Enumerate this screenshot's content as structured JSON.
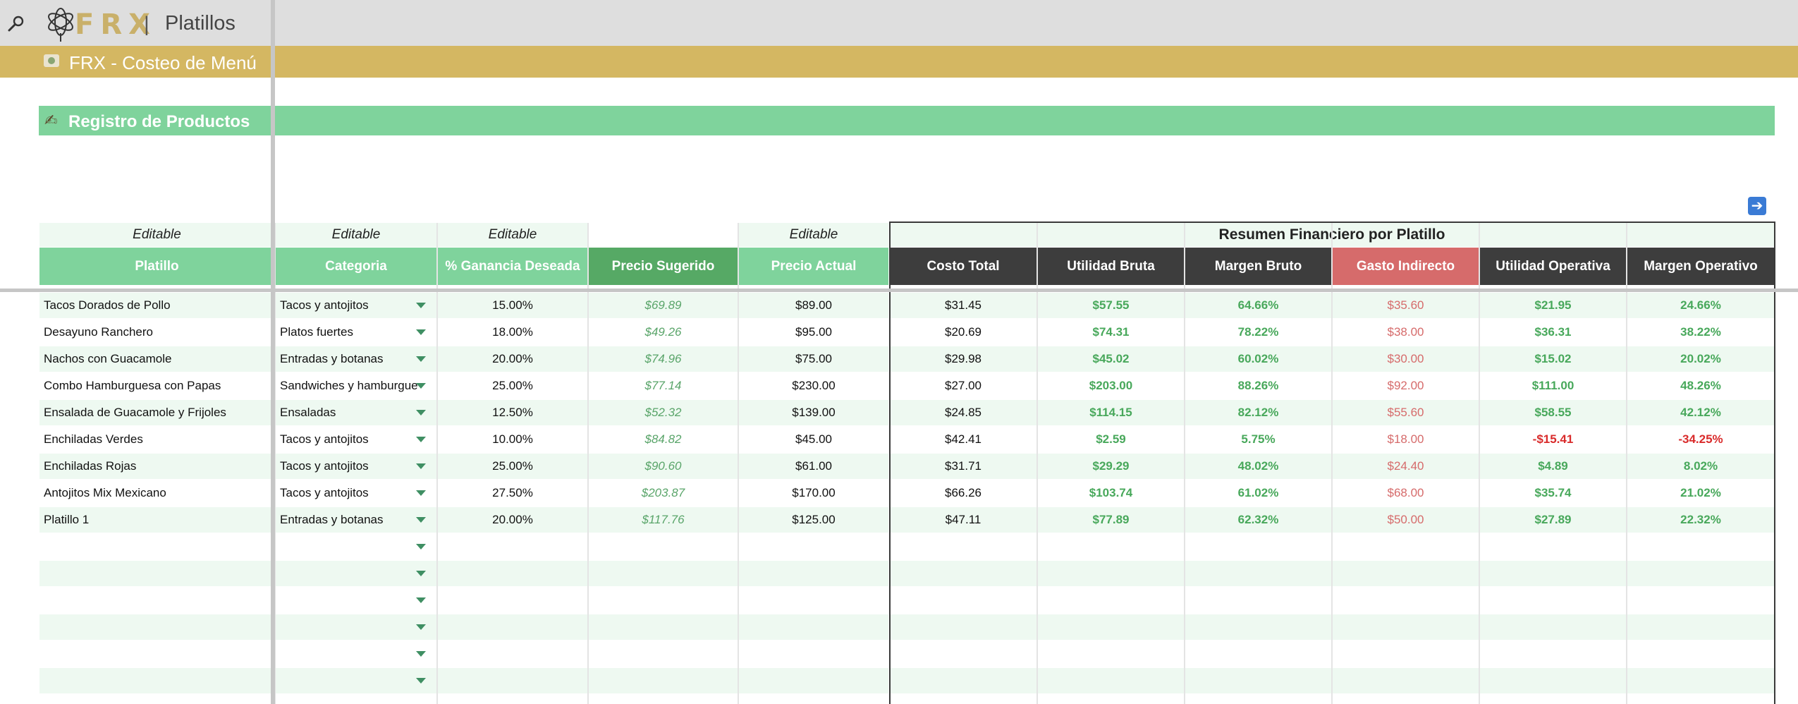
{
  "app": {
    "logo_text": "FRX",
    "separator": "|",
    "sheet_title": "Platillos"
  },
  "band": {
    "title": "FRX - Costeo de Menú"
  },
  "section": {
    "title": "Registro de Productos"
  },
  "editable_label": "Editable",
  "summary_title": "Resumen Financiero por Platillo",
  "columns": [
    "Platillo",
    "Categoria",
    "% Ganancia Deseada",
    "Precio Sugerido",
    "Precio Actual",
    "Costo Total",
    "Utilidad Bruta",
    "Margen Bruto",
    "Gasto Indirecto",
    "Utilidad Operativa",
    "Margen Operativo"
  ],
  "rows": [
    [
      "Tacos Dorados de Pollo",
      "Tacos y antojitos",
      "15.00%",
      "$69.89",
      "$89.00",
      "$31.45",
      "$57.55",
      "64.66%",
      "$35.60",
      "$21.95",
      "24.66%"
    ],
    [
      "Desayuno Ranchero",
      "Platos fuertes",
      "18.00%",
      "$49.26",
      "$95.00",
      "$20.69",
      "$74.31",
      "78.22%",
      "$38.00",
      "$36.31",
      "38.22%"
    ],
    [
      "Nachos con Guacamole",
      "Entradas y botanas",
      "20.00%",
      "$74.96",
      "$75.00",
      "$29.98",
      "$45.02",
      "60.02%",
      "$30.00",
      "$15.02",
      "20.02%"
    ],
    [
      "Combo Hamburguesa con Papas",
      "Sandwiches y hamburgue",
      "25.00%",
      "$77.14",
      "$230.00",
      "$27.00",
      "$203.00",
      "88.26%",
      "$92.00",
      "$111.00",
      "48.26%"
    ],
    [
      "Ensalada de Guacamole y Frijoles",
      "Ensaladas",
      "12.50%",
      "$52.32",
      "$139.00",
      "$24.85",
      "$114.15",
      "82.12%",
      "$55.60",
      "$58.55",
      "42.12%"
    ],
    [
      "Enchiladas Verdes",
      "Tacos y antojitos",
      "10.00%",
      "$84.82",
      "$45.00",
      "$42.41",
      "$2.59",
      "5.75%",
      "$18.00",
      "-$15.41",
      "-34.25%"
    ],
    [
      "Enchiladas Rojas",
      "Tacos y antojitos",
      "25.00%",
      "$90.60",
      "$61.00",
      "$31.71",
      "$29.29",
      "48.02%",
      "$24.40",
      "$4.89",
      "8.02%"
    ],
    [
      "Antojitos Mix Mexicano",
      "Tacos y antojitos",
      "27.50%",
      "$203.87",
      "$170.00",
      "$66.26",
      "$103.74",
      "61.02%",
      "$68.00",
      "$35.74",
      "21.02%"
    ],
    [
      "Platillo 1",
      "Entradas y botanas",
      "20.00%",
      "$117.76",
      "$125.00",
      "$47.11",
      "$77.89",
      "62.32%",
      "$50.00",
      "$27.89",
      "22.32%"
    ]
  ],
  "colors": {
    "gold": "#d4b762",
    "green": "#7fd39c",
    "dark_green": "#56a965",
    "dark": "#3d3d3d",
    "red_header": "#d66b6b",
    "positive": "#48a85b",
    "negative": "#d92b2b"
  },
  "icons": {
    "search": "magnifier-icon",
    "logo": "atom-logo-icon",
    "band": "money-icon",
    "section": "pencil-icon",
    "next": "arrow-right-icon",
    "dropdown": "dropdown-arrow-icon"
  }
}
